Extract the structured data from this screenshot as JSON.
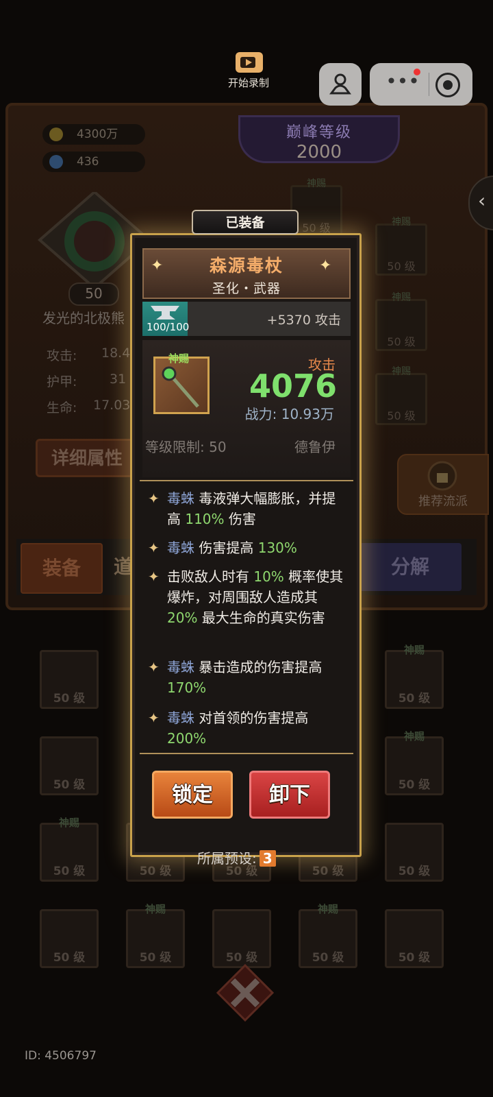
{
  "recorder": {
    "label": "开始录制"
  },
  "resources": {
    "gold": "4300万",
    "gems": "436"
  },
  "peak_level": {
    "title": "巅峰等级",
    "value": "2000"
  },
  "hero": {
    "level": "50",
    "name": "发光的北极熊",
    "stats": [
      {
        "label": "攻击:",
        "value": "18.4"
      },
      {
        "label": "护甲:",
        "value": "31"
      },
      {
        "label": "生命:",
        "value": "17.03"
      }
    ],
    "detail_button": "详细属性"
  },
  "recommend": {
    "label": "推荐流派"
  },
  "tabs": {
    "equip": "装备",
    "item": "道",
    "decompose": "分解"
  },
  "slots": {
    "level_label": "50 级",
    "god_label": "神赐"
  },
  "popup": {
    "equipped_tag": "已装备",
    "item_name": "森源毒杖",
    "item_subtitle": "圣化・武器",
    "anvil_count": "100/100",
    "anvil_bonus": "+5370 攻击",
    "god_tag": "神赐",
    "attack_label": "攻击",
    "attack_value": "4076",
    "power": "战力: 10.93万",
    "level_limit": "等级限制: 50",
    "class": "德鲁伊",
    "effects": [
      {
        "keyword": "毒蛛",
        "parts": [
          " 毒液弹大幅膨胀，并提高 ",
          "110%",
          " 伤害"
        ]
      },
      {
        "keyword": "毒蛛",
        "parts": [
          " 伤害提高 ",
          "130%",
          ""
        ]
      },
      {
        "keyword": "",
        "parts": [
          "击败敌人时有 ",
          "10%",
          " 概率使其爆炸，对周围敌人造成其 ",
          "20%",
          " 最大生命的真实伤害"
        ]
      },
      {
        "keyword": "毒蛛",
        "parts": [
          " 暴击造成的伤害提高 ",
          "170%",
          ""
        ]
      },
      {
        "keyword": "毒蛛",
        "parts": [
          " 对首领的伤害提高",
          "200%",
          ""
        ]
      }
    ],
    "lock_button": "锁定",
    "unequip_button": "卸下",
    "preset_label": "所属预设:",
    "preset_value": "3"
  },
  "footer": {
    "user_id": "ID: 4506797"
  },
  "colors": {
    "gold_border": "#c9a24b",
    "attack_green": "#7fe06d",
    "keyword_blue": "#8fa6d8",
    "percent_green": "#8fd86f",
    "name_orange": "#f4ad6a"
  }
}
